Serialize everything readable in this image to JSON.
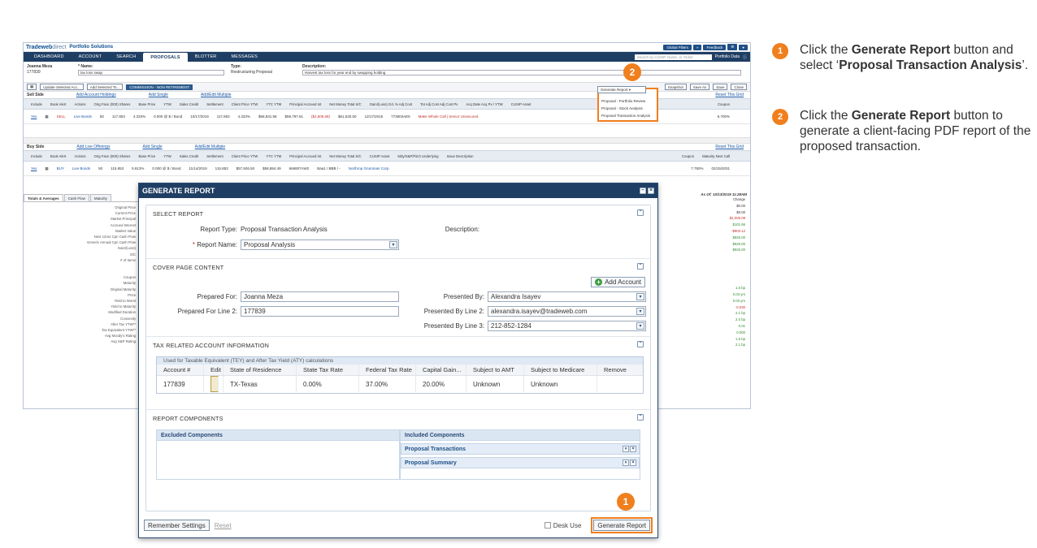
{
  "app": {
    "logo": "Tradeweb",
    "logo_suffix": "direct",
    "product": "Portfolio Solutions",
    "top_buttons": [
      "Global Filters",
      "Feedback"
    ],
    "nav_tabs": [
      "DASHBOARD",
      "ACCOUNT",
      "SEARCH",
      "PROPOSALS",
      "BLOTTER",
      "MESSAGES"
    ],
    "active_tab": "PROPOSALS",
    "cusip_placeholder": "Search by CUSIP, Name, or Ticker",
    "portfolio_data": "Portfolio Data"
  },
  "strip": {
    "client_name": "Joanna Meza",
    "client_id": "177839",
    "name_label": "* Name:",
    "name_value": "tax loss swap",
    "type_label": "Type:",
    "type_value": "Restructuring Proposal",
    "desc_label": "Description:",
    "desc_value": "Harvest tax loss for year end by swapping holding"
  },
  "toolbar": {
    "update_selected": "Update Selected Acc...",
    "add_selected": "Add Selected To...",
    "commission": "COMMISSION - NON RETIREMENT",
    "generate_report": "Generate Report",
    "snapshot": "Snapshot",
    "save_as": "Save As",
    "save": "Save",
    "close": "Close"
  },
  "dropdown": {
    "items": [
      "Proposal - Portfolio Review",
      "Proposal - Stock Analysis",
      "Proposal Transaction Analysis"
    ]
  },
  "sell_side": {
    "title": "Sell Side",
    "links": [
      "Add Account Holdings",
      "Add Single",
      "Add/Edit Multiple"
    ],
    "reset": "Reset This Grid",
    "headers": [
      "Include",
      "Book Alert",
      "Actions",
      "Orig Face (000) Shares",
      "Base Price",
      "YTW",
      "Sales Credit",
      "Settlement",
      "Client Price YTW",
      "YTC YTM",
      "Principal Accrued Int",
      "Net Money Total S/C",
      "Gain/(Loss) G/L % Adj Cost",
      "Tot Adj Cost Adj Cost Px",
      "Acq Date Acq Px / YTW",
      "CUSIP Asset",
      "Coupon"
    ],
    "row": {
      "include": "Yes",
      "action": "SELL",
      "action2": "Live Bonds",
      "face": "50",
      "base_price": "117.853",
      "ytw": "4.333%",
      "sales_credit": "0.000 @ $ / Bond",
      "settlement": "10/17/2019",
      "client_price": "117.853",
      "client_ytw": "4.333%",
      "ytm": "4.333%",
      "principal": "$58,931.58",
      "accrued": "$866.11",
      "net_money": "$59,797.61",
      "total_sc": "$0.00",
      "gain_loss": "($2,608.68)",
      "gl_pct": "(4.24%)",
      "adj_cost": "$61,530.50",
      "adj_cost_px": "123.079",
      "acq_date": "12/17/2015",
      "acq_px": "123.721 / 3.726%",
      "cusip": "773903AE5",
      "asset": "Corp Hist",
      "issuer": "Make Whole Call | Senior Unsecured",
      "coupon": "6.700%"
    }
  },
  "buy_side": {
    "title": "Buy Side",
    "links": [
      "Add Live Offerings",
      "Add Single",
      "Add/Edit Multiple"
    ],
    "reset": "Reset This Grid",
    "headers": [
      "Include",
      "Book Alert",
      "Actions",
      "Orig Face (000) Shares",
      "Base Price",
      "YTW",
      "Sales Credit",
      "Settlement",
      "Client Price YTW",
      "YTC YTM",
      "Principal Accrued Int",
      "Net Money Total S/C",
      "CUSIP Asset",
      "Mdy/S&P/Fitch Underlying",
      "Issue Description",
      "Coupon",
      "Maturity Next Call"
    ],
    "row": {
      "include": "Yes",
      "action": "BUY",
      "action2": "Live Bonds",
      "face": "50",
      "base_price": "115.853",
      "ytw": "5.913%",
      "sales_credit": "0.000 @ $ / Bond",
      "settlement": "11/14/2019",
      "client_price": "115.853",
      "principal": "$57,926.50",
      "net_money": "$58,884.49",
      "cusip": "666807AW2",
      "rating": "Baa1 / BBB / -",
      "issuer": "Northrop Grumman Corp",
      "coupon": "7.750%",
      "maturity": "02/15/2031"
    }
  },
  "left_tabs": [
    "Totals & Averages",
    "Cash Flow",
    "Maturity"
  ],
  "left_labels": [
    "Original Price",
    "Current Price",
    "Market Principal",
    "Accrued Interest",
    "Market Value",
    "Next 12mo Cpn Cash Flow",
    "Generic Annual Cpn Cash Flow",
    "Gain/(Loss)",
    "S/C",
    "# of Items",
    "",
    "",
    "Coupon",
    "Maturity",
    "Original Maturity",
    "Price",
    "Yield to Worst",
    "Yield to Maturity",
    "Modified Duration",
    "Convexity",
    "After Tax YTW**",
    "Tax Equivalent YTW**",
    "Avg Moody's Rating",
    "Avg S&P Rating"
  ],
  "as_of": "As Of: 10/13/2019 11:28AM",
  "right_values": [
    {
      "v": "Change",
      "c": "n"
    },
    {
      "v": "$0.00",
      "c": "n"
    },
    {
      "v": "$0.00",
      "c": "n"
    },
    {
      "v": "-$1,005.08",
      "c": "r"
    },
    {
      "v": "$101.66",
      "c": "g"
    },
    {
      "v": "-$903.12",
      "c": "r"
    },
    {
      "v": "$925.00",
      "c": "g"
    },
    {
      "v": "$925.00",
      "c": "g"
    },
    {
      "v": "$925.00",
      "c": "g"
    },
    {
      "v": "",
      "c": "n"
    },
    {
      "v": "",
      "c": "n"
    },
    {
      "v": "",
      "c": "n"
    },
    {
      "v": "",
      "c": "n"
    },
    {
      "v": "",
      "c": "n"
    },
    {
      "v": "1.6 bp",
      "c": "g"
    },
    {
      "v": "0.03 yrs",
      "c": "g"
    },
    {
      "v": "0.03 yrs",
      "c": "g"
    },
    {
      "v": "-0.030",
      "c": "r"
    },
    {
      "v": "2.1 bp",
      "c": "g"
    },
    {
      "v": "2.0 bp",
      "c": "g"
    },
    {
      "v": "0.01",
      "c": "g"
    },
    {
      "v": "0.000",
      "c": "g"
    },
    {
      "v": "1.5 bp",
      "c": "g"
    },
    {
      "v": "2.1 bp",
      "c": "g"
    }
  ],
  "modal": {
    "title": "GENERATE REPORT",
    "select_report": {
      "title": "SELECT REPORT",
      "report_type_label": "Report Type:",
      "report_type_value": "Proposal Transaction Analysis",
      "description_label": "Description:",
      "report_name_label": "Report Name:",
      "report_name_value": "Proposal Analysis"
    },
    "cover": {
      "title": "COVER PAGE CONTENT",
      "add_account": "Add Account",
      "prepared_for_label": "Prepared For:",
      "prepared_for_value": "Joanna Meza",
      "prepared_line2_label": "Prepared For Line 2:",
      "prepared_line2_value": "177839",
      "presented_by_label": "Presented By:",
      "presented_by_value": "Alexandra Isayev",
      "presented_line2_label": "Presented By Line 2:",
      "presented_line2_value": "alexandra.isayev@tradeweb.com",
      "presented_line3_label": "Presented By Line 3:",
      "presented_line3_value": "212-852-1284"
    },
    "tax": {
      "title": "TAX RELATED ACCOUNT INFORMATION",
      "caption": "Used for Taxable Equivalent (TEY) and After Tax Yield (ATY) calculations",
      "headers": [
        "Account #",
        "Edit",
        "State of Residence",
        "State Tax Rate",
        "Federal Tax Rate",
        "Capital Gain...",
        "Subject to AMT",
        "Subject to Medicare",
        "Remove"
      ],
      "row": {
        "account": "177839",
        "state": "TX-Texas",
        "state_rate": "0.00%",
        "fed_rate": "37.00%",
        "cap_gain": "20.00%",
        "amt": "Unknown",
        "medicare": "Unknown"
      }
    },
    "components": {
      "title": "REPORT COMPONENTS",
      "excluded_title": "Excluded Components",
      "included_title": "Included Components",
      "included": [
        "Proposal Transactions",
        "Proposal Summary"
      ]
    },
    "footer": {
      "remember": "Remember Settings",
      "reset": "Reset",
      "desk_use": "Desk Use",
      "generate": "Generate Report"
    }
  },
  "instructions": [
    {
      "num": "1",
      "pre": "Click the ",
      "bold1": "Generate Report",
      "mid": " button and select ‘",
      "bold2": "Proposal Transaction Analysis",
      "post": "’."
    },
    {
      "num": "2",
      "pre": "Click the ",
      "bold1": "Generate Report",
      "mid": " button to generate a client-facing PDF report of the proposed transaction.",
      "bold2": "",
      "post": ""
    }
  ],
  "markers": [
    "2",
    "1"
  ],
  "colors": {
    "accent": "#f07f1e",
    "nav": "#1f3e63",
    "link": "#1a57a6"
  }
}
